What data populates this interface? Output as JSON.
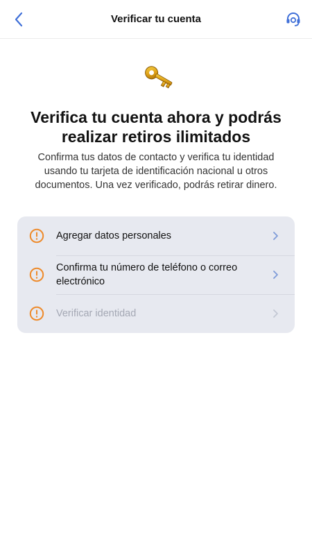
{
  "header": {
    "title": "Verificar tu cuenta",
    "back_icon": "chevron-left-icon",
    "support_icon": "headset-support-icon"
  },
  "hero": {
    "icon": "key-icon",
    "headline": "Verifica tu cuenta ahora y podrás realizar retiros ilimitados",
    "description": "Confirma tus datos de contacto y verifica tu identidad usando tu tarjeta de identificación nacional u otros documentos. Una vez verificado, podrás retirar dinero."
  },
  "steps": [
    {
      "label": "Agregar datos personales",
      "status_icon": "warning-circle-icon",
      "disabled": false
    },
    {
      "label": "Confirma tu número de teléfono o correo electrónico",
      "status_icon": "warning-circle-icon",
      "disabled": false
    },
    {
      "label": "Verificar identidad",
      "status_icon": "warning-circle-icon",
      "disabled": true
    }
  ],
  "colors": {
    "accent": "#3f6fd8",
    "warning": "#ee8a2a",
    "card_bg": "#e7e9f0",
    "disabled_text": "#a4a8b4"
  }
}
